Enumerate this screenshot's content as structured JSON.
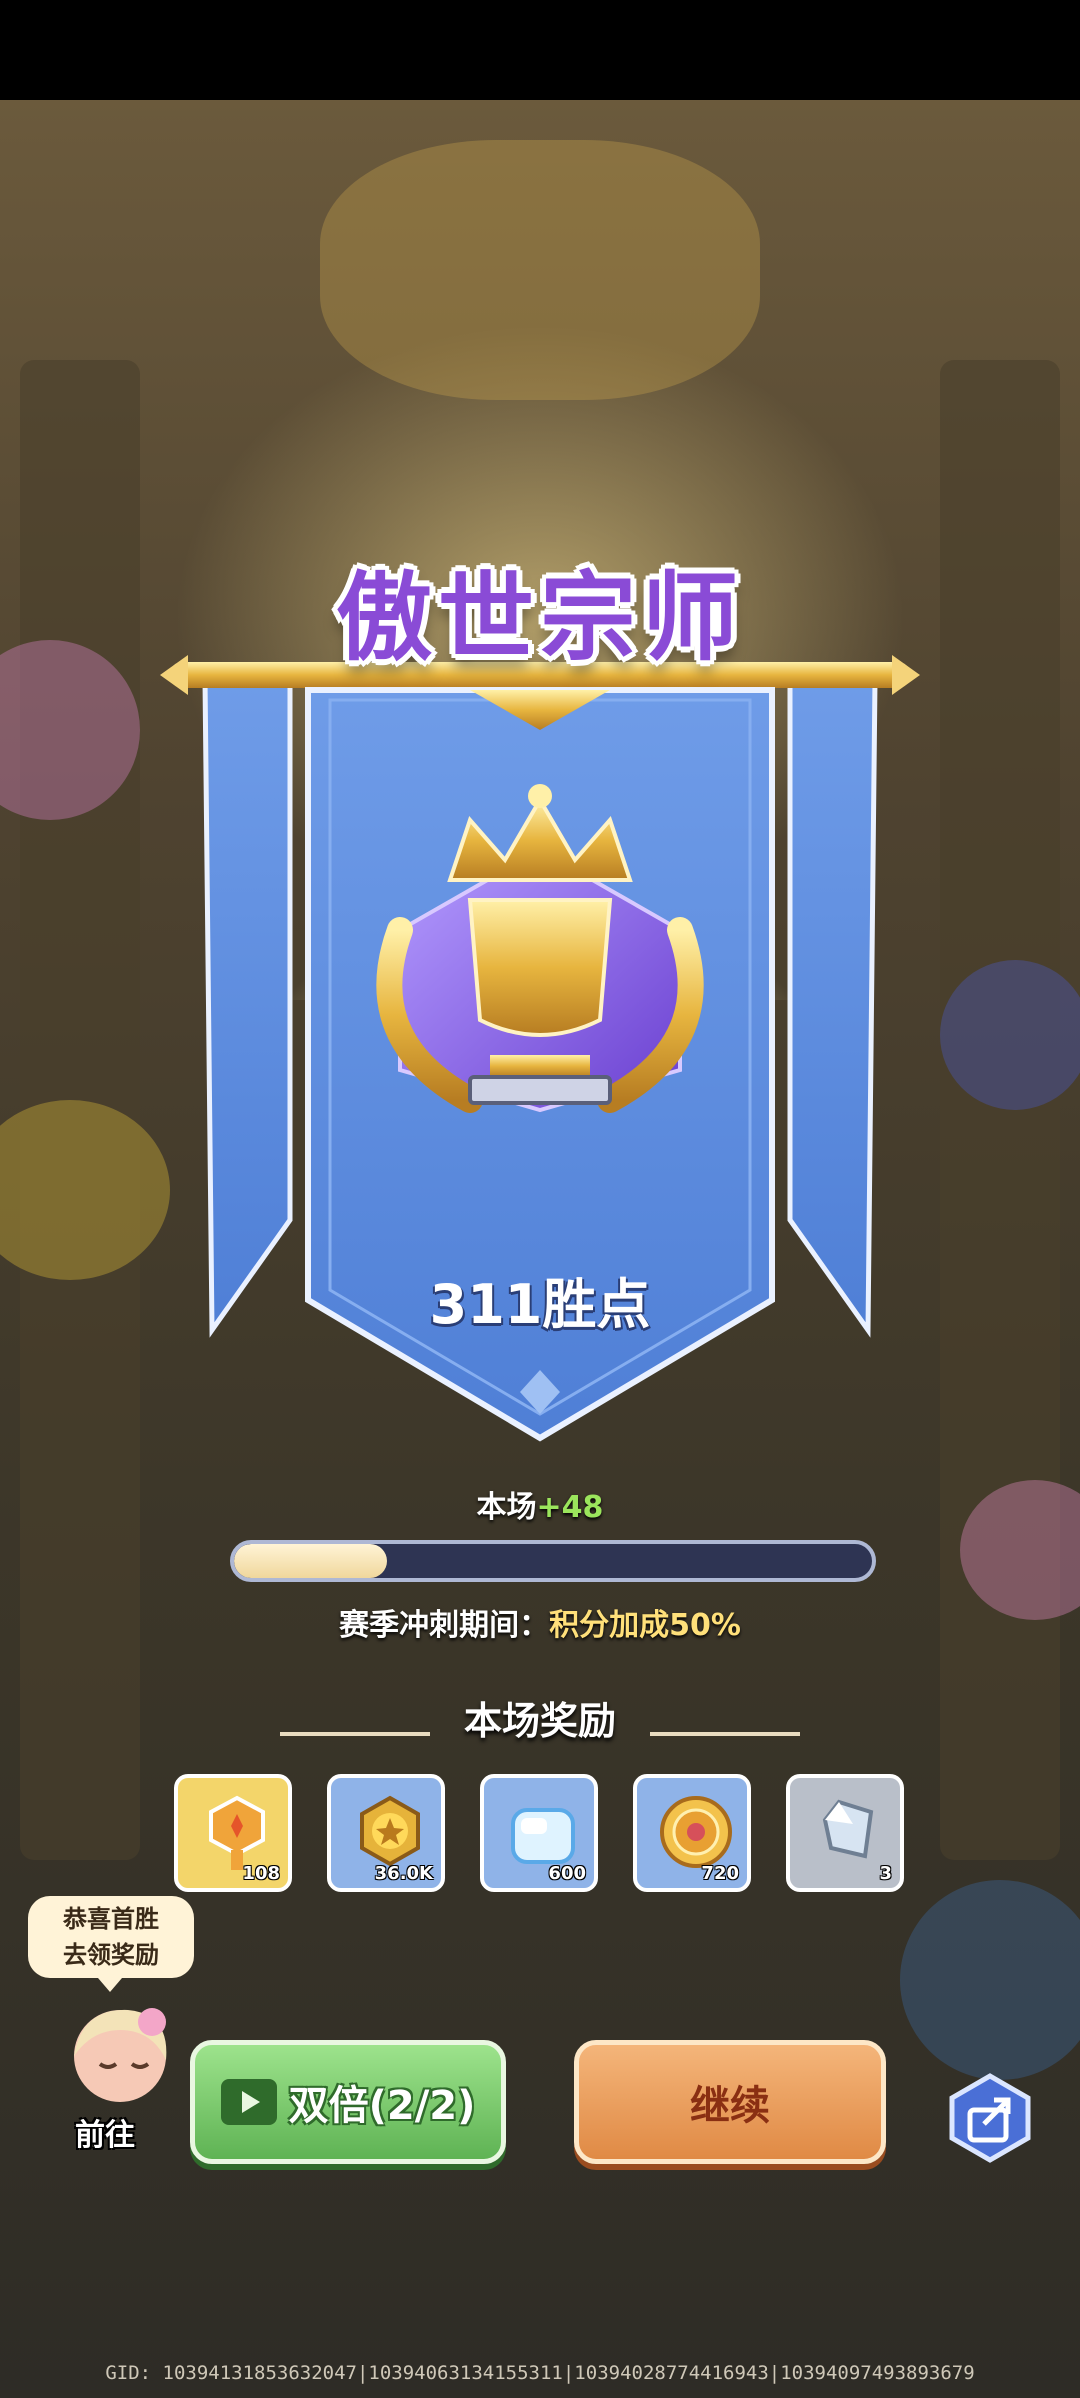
{
  "rank": {
    "title": "傲世宗师",
    "score": "311胜点"
  },
  "progress": {
    "gain_label": "本场",
    "gain_value": "+48",
    "fraction": 0.24
  },
  "season": {
    "label": "赛季冲刺期间：",
    "bonus": "积分加成50%"
  },
  "rewards": {
    "title": "本场奖励",
    "items": [
      {
        "icon": "key-icon",
        "count": "108",
        "bg": "#f3d56a"
      },
      {
        "icon": "gold-coin-icon",
        "count": "36.0K",
        "bg": "#8fb3e8"
      },
      {
        "icon": "ice-cube-icon",
        "count": "600",
        "bg": "#8fb3e8"
      },
      {
        "icon": "medal-coin-icon",
        "count": "720",
        "bg": "#8fb3e8"
      },
      {
        "icon": "crystal-shard-icon",
        "count": "3",
        "bg": "#b9bfc9"
      }
    ]
  },
  "promo": {
    "bubble_line1": "恭喜首胜",
    "bubble_line2": "去领奖励",
    "goto": "前往"
  },
  "buttons": {
    "double": "双倍(2/2)",
    "continue": "继续"
  },
  "footer": {
    "gid": "GID: 10394131853632047|10394063134155311|10394028774416943|10394097493893679"
  },
  "colors": {
    "banner": "#5b8be0",
    "title": "#8a4bd6",
    "accent_green": "#9be55c"
  }
}
